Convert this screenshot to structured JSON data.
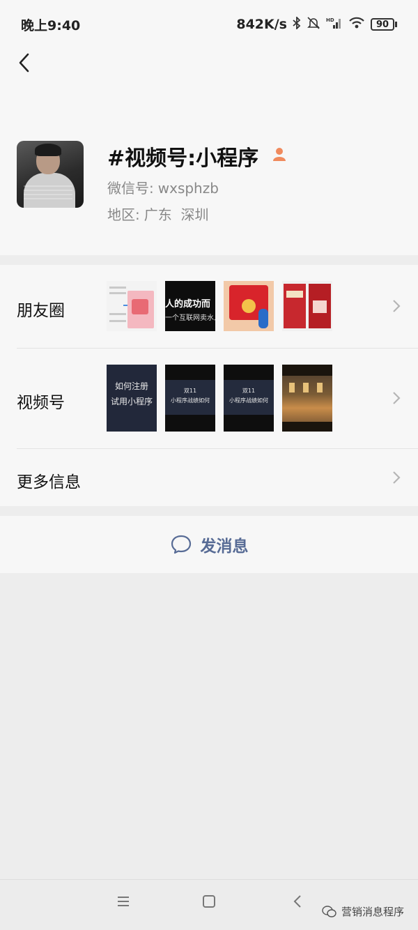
{
  "status_bar": {
    "time": "晚上9:40",
    "network_speed": "842K/s",
    "battery": "90",
    "icons": [
      "bluetooth-icon",
      "mute-bell-icon",
      "hd-signal-icon",
      "wifi-icon",
      "battery-icon"
    ]
  },
  "nav": {
    "back_icon": "chevron-left-icon"
  },
  "profile": {
    "name": "#视频号:小程序",
    "wechat_id_label": "微信号:",
    "wechat_id": "wxsphzb",
    "region_label": "地区:",
    "region": "广东  深圳",
    "verify_icon": "person-verified-icon",
    "verify_color": "#f08a5d"
  },
  "rows": {
    "moments": {
      "label": "朋友圈",
      "thumb2_line1": "人的成功而",
      "thumb2_line2": "一个互联网卖水人"
    },
    "channels": {
      "label": "视频号",
      "thumb1_line1": "如何注册",
      "thumb1_line2": "试用小程序",
      "thumb2_line1": "双11",
      "thumb2_line2": "小程序战绩如何",
      "thumb3_line1": "双11",
      "thumb3_line2": "小程序战绩如何"
    },
    "more": {
      "label": "更多信息"
    }
  },
  "message": {
    "label": "发消息",
    "icon": "chat-bubble-icon",
    "accent": "#576b95"
  },
  "bottom_nav": {
    "menu_icon": "menu-icon",
    "home_icon": "square-home-icon",
    "back_icon": "triangle-back-icon"
  },
  "watermark": {
    "text": "营销消息程序"
  }
}
